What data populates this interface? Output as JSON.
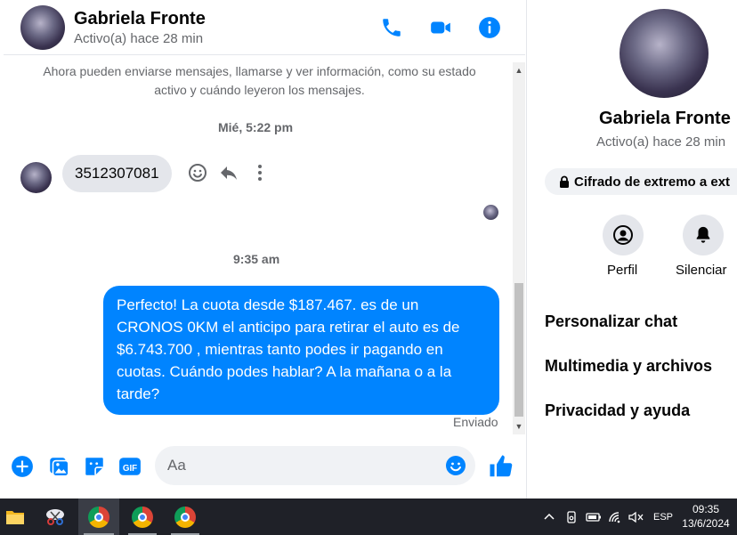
{
  "header": {
    "name": "Gabriela Fronte",
    "status": "Activo(a) hace 28 min"
  },
  "chat": {
    "system_message": "Ahora pueden enviarse mensajes, llamarse y ver información, como su estado activo y cuándo leyeron los mensajes.",
    "timestamp_1": "Mié, 5:22 pm",
    "incoming_message": "3512307081",
    "timestamp_2": "9:35 am",
    "outgoing_message": "Perfecto! La cuota desde $187.467. es de un CRONOS 0KM el anticipo para retirar el auto es de $6.743.700 , mientras tanto podes ir pagando en cuotas. Cuándo podes hablar? A la mañana o a la tarde?",
    "sent_status": "Enviado"
  },
  "composer": {
    "placeholder": "Aa"
  },
  "panel": {
    "name": "Gabriela Fronte",
    "status": "Activo(a) hace 28 min",
    "encryption": "Cifrado de extremo a ext",
    "profile_label": "Perfil",
    "mute_label": "Silenciar",
    "items": [
      "Personalizar chat",
      "Multimedia y archivos",
      "Privacidad y ayuda"
    ]
  },
  "taskbar": {
    "language": "ESP",
    "time": "09:35",
    "date": "13/6/2024"
  },
  "colors": {
    "accent": "#0084ff",
    "incoming_bubble": "#e4e6eb",
    "taskbar": "#1f2128"
  }
}
